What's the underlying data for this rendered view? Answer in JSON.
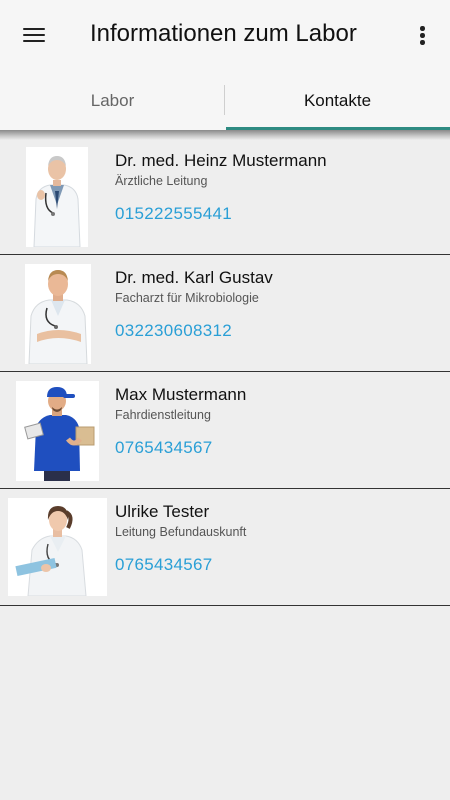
{
  "appbar": {
    "title": "Informationen zum Labor",
    "menu_icon": "hamburger-menu-icon",
    "more_icon": "more-vert-icon"
  },
  "tabs": [
    {
      "label": "Labor",
      "active": false
    },
    {
      "label": "Kontakte",
      "active": true
    }
  ],
  "colors": {
    "accent": "#2e8b82",
    "phone_link": "#2a9fd6",
    "background": "#eeeeee"
  },
  "contacts": [
    {
      "name": "Dr. med. Heinz Mustermann",
      "role": "Ärztliche Leitung",
      "phone": "015222555441",
      "photo": "doctor-portrait-photo"
    },
    {
      "name": "Dr. med. Karl Gustav",
      "role": "Facharzt für Mikrobiologie",
      "phone": "032230608312",
      "photo": "doctor-portrait-photo"
    },
    {
      "name": "Max Mustermann",
      "role": "Fahrdienstleitung",
      "phone": "0765434567",
      "photo": "courier-portrait-photo"
    },
    {
      "name": "Ulrike Tester",
      "role": "Leitung Befundauskunft",
      "phone": "0765434567",
      "photo": "nurse-portrait-photo"
    }
  ]
}
